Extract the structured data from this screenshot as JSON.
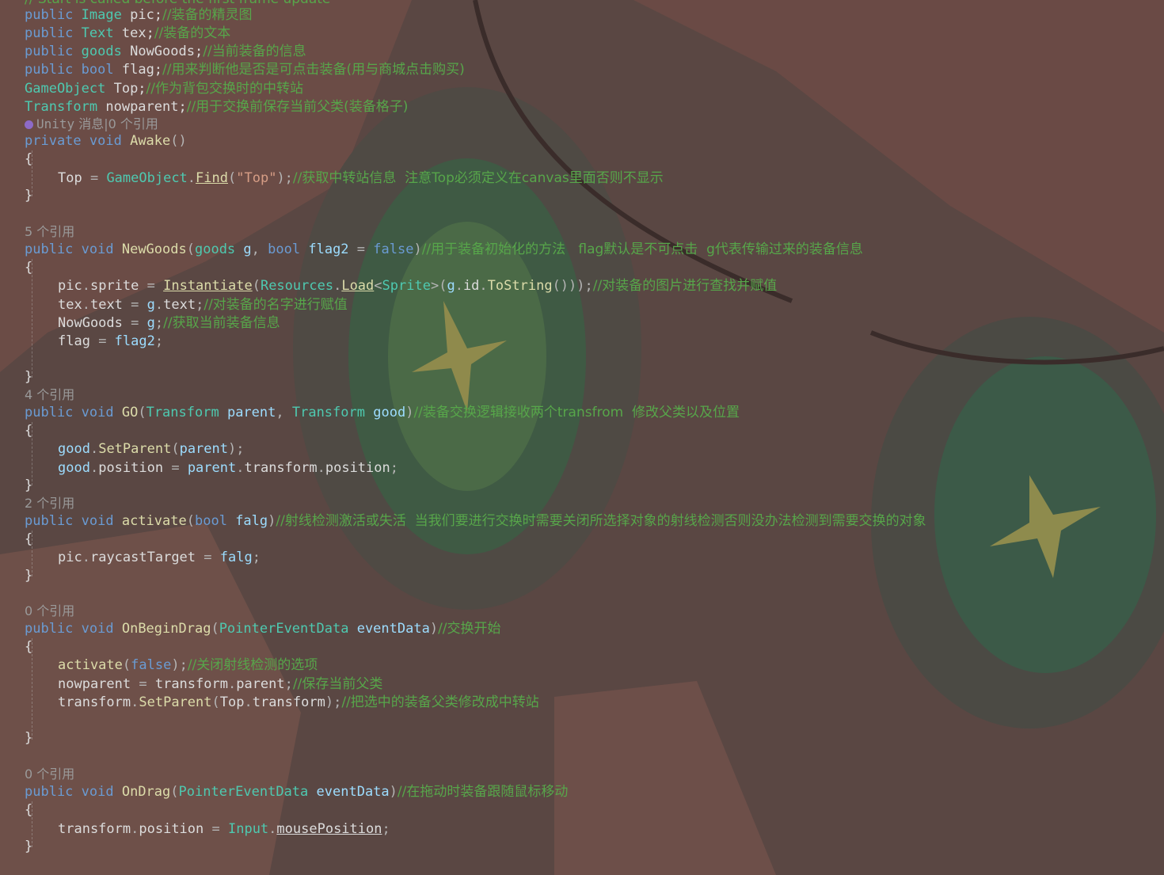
{
  "top_partial": "// Start is called before the first frame update",
  "code": {
    "l1": {
      "kw": "public",
      "ty": "Image",
      "nm": " pic;",
      "cm": "//装备的精灵图"
    },
    "l2": {
      "kw": "public",
      "ty": "Text",
      "nm": " tex;",
      "cm": "//装备的文本"
    },
    "l3": {
      "kw": "public",
      "ty": "goods",
      "nm": " NowGoods;",
      "cm": "//当前装备的信息"
    },
    "l4": {
      "kw": "public",
      "ty": "bool",
      "nm": " flag;",
      "cm": "//用来判断他是否是可点击装备(用与商城点击购买)"
    },
    "l5": {
      "ty": "GameObject",
      "nm": " Top;",
      "cm": "//作为背包交换时的中转站"
    },
    "l6": {
      "ty": "Transform",
      "nm": " nowparent;",
      "cm": "//用于交换前保存当前父类(装备格子)"
    },
    "lens_awake": {
      "unity": "Unity",
      "text": " 消息|0 个引用"
    },
    "awake_sig": {
      "kw": "private void",
      "mt": "Awake",
      "pu": "()"
    },
    "awake_body": {
      "a": "Top",
      "b": " = ",
      "ty": "GameObject",
      "mt": "Find",
      "st": "\"Top\"",
      "cm": "//获取中转站信息  注意Top必须定义在canvas里面否则不显示"
    },
    "lens_newgoods": "5 个引用",
    "newgoods_sig": {
      "kw": "public void",
      "mt": "NewGoods",
      "ty1": "goods",
      "p1": "g",
      "kw2": "bool",
      "p2": "flag2",
      "kw3": "false",
      "cm": "//用于装备初始化的方法   flag默认是不可点击  g代表传输过来的装备信息"
    },
    "ng1": {
      "a": "pic",
      "b": "sprite",
      "mt": "Instantiate",
      "ty": "Resources",
      "mt2": "Load",
      "ty2": "Sprite",
      "c": "g",
      "d": "id",
      "mt3": "ToString",
      "cm": "//对装备的图片进行查找并赋值"
    },
    "ng2": {
      "a": "tex",
      "b": "text",
      "c": "g",
      "d": "text",
      "cm": "//对装备的名字进行赋值"
    },
    "ng3": {
      "a": "NowGoods",
      "c": "g",
      "cm": "//获取当前装备信息"
    },
    "ng4": {
      "a": "flag",
      "c": "flag2"
    },
    "lens_go": "4 个引用",
    "go_sig": {
      "kw": "public void",
      "mt": "GO",
      "ty": "Transform",
      "p1": "parent",
      "p2": "good",
      "cm": "//装备交换逻辑接收两个transfrom  修改父类以及位置"
    },
    "go1": {
      "a": "good",
      "mt": "SetParent",
      "p": "parent"
    },
    "go2": {
      "a": "good",
      "b": "position",
      "c": "parent",
      "d": "transform",
      "e": "position"
    },
    "lens_activate": "2 个引用",
    "act_sig": {
      "kw": "public void",
      "mt": "activate",
      "kw2": "bool",
      "p": "falg",
      "cm": "//射线检测激活或失活  当我们要进行交换时需要关闭所选择对象的射线检测否则没办法检测到需要交换的对象"
    },
    "act1": {
      "a": "pic",
      "b": "raycastTarget",
      "c": "falg"
    },
    "lens_begindrag": "0 个引用",
    "bd_sig": {
      "kw": "public void",
      "mt": "OnBeginDrag",
      "ty": "PointerEventData",
      "p": "eventData",
      "cm": "//交换开始"
    },
    "bd1": {
      "mt": "activate",
      "kw": "false",
      "cm": "//关闭射线检测的选项"
    },
    "bd2": {
      "a": "nowparent",
      "b": "transform",
      "c": "parent",
      "cm": "//保存当前父类"
    },
    "bd3": {
      "a": "transform",
      "mt": "SetParent",
      "b": "Top",
      "c": "transform",
      "cm": "//把选中的装备父类修改成中转站"
    },
    "lens_drag": "0 个引用",
    "dr_sig": {
      "kw": "public void",
      "mt": "OnDrag",
      "ty": "PointerEventData",
      "p": "eventData",
      "cm": "//在拖动时装备跟随鼠标移动"
    },
    "dr1": {
      "a": "transform",
      "b": "position",
      "ty": "Input",
      "c": "mousePosition"
    }
  },
  "colors": {
    "keyword": "#6a9bd3",
    "type": "#4ec9b0",
    "comment": "#57a64a",
    "string": "#d69d85",
    "method": "#dcdcaa",
    "background": "#5e4a46"
  }
}
